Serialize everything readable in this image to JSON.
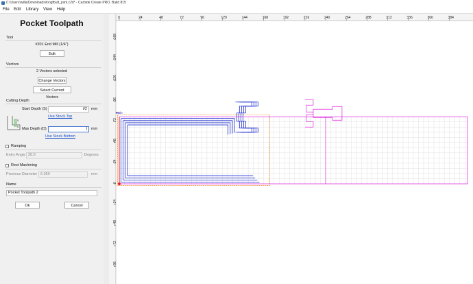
{
  "window": {
    "title": "C:\\Users\\willa\\Downloads\\longfbutt_joint.c2d* - Carbide Create PRO, Build 815"
  },
  "menu": [
    {
      "label": "File",
      "mnemonic": "F"
    },
    {
      "label": "Edit",
      "mnemonic": "E"
    },
    {
      "label": "Library",
      "mnemonic": "L"
    },
    {
      "label": "View",
      "mnemonic": "V"
    },
    {
      "label": "Help",
      "mnemonic": "H"
    }
  ],
  "panel": {
    "heading": "Pocket Toolpath",
    "tool": {
      "section": "Tool",
      "name": "#201 End Mill (1/4\")",
      "edit": "Edit"
    },
    "vectors": {
      "section": "Vectors",
      "status": "2 Vectors selected",
      "change": "Change Vectors",
      "select_current": "Select Current Vectors"
    },
    "cutting": {
      "section": "Cutting Depth",
      "start_label": "Start Depth (S)",
      "start_value": "t/2",
      "start_unit": "mm",
      "use_stock_top": "Use Stock Top",
      "max_label": "Max Depth (D)",
      "max_value": "t",
      "max_unit": "mm",
      "use_stock_bottom": "Use Stock Bottom",
      "diagram_s": "S",
      "diagram_d": "D"
    },
    "ramping": {
      "label": "Ramping",
      "checked": false,
      "angle_label": "Entry Angle",
      "angle_value": "20.0",
      "angle_unit": "Degrees"
    },
    "rest": {
      "label": "Rest Machining",
      "checked": false,
      "diam_label": "Previous Diameter",
      "diam_value": "6.350",
      "diam_unit": "mm"
    },
    "name": {
      "section": "Name",
      "value": "Pocket Toolpath 2"
    },
    "ok": "Ok",
    "cancel": "Cancel"
  },
  "canvas": {
    "hruler_labels": [
      "0",
      "24",
      "48",
      "72",
      "96",
      "120",
      "144",
      "168",
      "192",
      "216",
      "240",
      "264",
      "288",
      "312",
      "336",
      "360",
      "384"
    ],
    "vruler_labels": [
      "168",
      "144",
      "120",
      "96",
      "72",
      "48",
      "24",
      "0",
      "-24",
      "-48",
      "-72",
      "-96"
    ],
    "origin_label": "Table",
    "colors": {
      "vector": "#e020e0",
      "toolpath_blue": "#1e2fd0",
      "toolpath_orange": "#f08020",
      "origin_red": "#e02020",
      "grid": "#d8d8d8"
    }
  }
}
